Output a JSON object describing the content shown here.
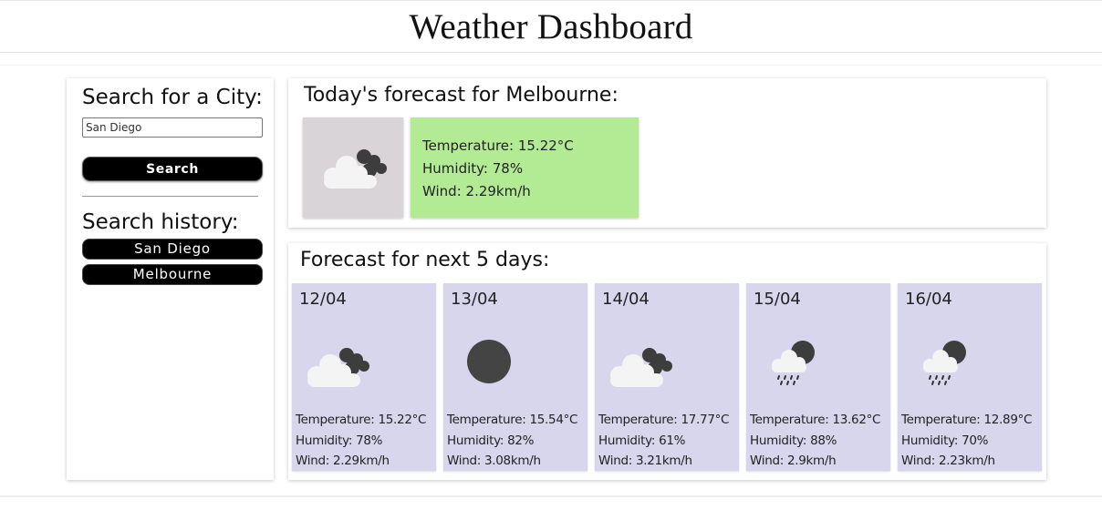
{
  "header": {
    "title": "Weather Dashboard"
  },
  "sidebar": {
    "search_heading": "Search for a City:",
    "input_value": "San Diego",
    "search_button": "Search",
    "history_heading": "Search history:",
    "history": [
      "San Diego",
      "Melbourne"
    ]
  },
  "today": {
    "heading": "Today's forecast for Melbourne:",
    "icon": "cloudy-partly-icon",
    "temperature": "Temperature: 15.22°C",
    "humidity": "Humidity: 78%",
    "wind": "Wind: 2.29km/h"
  },
  "forecast": {
    "heading": "Forecast for next 5 days:",
    "days": [
      {
        "date": "12/04",
        "icon": "cloudy-icon",
        "temperature": "Temperature: 15.22°C",
        "humidity": "Humidity: 78%",
        "wind": "Wind: 2.29km/h"
      },
      {
        "date": "13/04",
        "icon": "sun-icon",
        "temperature": "Temperature: 15.54°C",
        "humidity": "Humidity: 82%",
        "wind": "Wind: 3.08km/h"
      },
      {
        "date": "14/04",
        "icon": "cloudy-icon",
        "temperature": "Temperature: 17.77°C",
        "humidity": "Humidity: 61%",
        "wind": "Wind: 3.21km/h"
      },
      {
        "date": "15/04",
        "icon": "rain-icon",
        "temperature": "Temperature: 13.62°C",
        "humidity": "Humidity: 88%",
        "wind": "Wind: 2.9km/h"
      },
      {
        "date": "16/04",
        "icon": "rain-icon",
        "temperature": "Temperature: 12.89°C",
        "humidity": "Humidity: 70%",
        "wind": "Wind: 2.23km/h"
      }
    ]
  },
  "colors": {
    "today_stats_bg": "#b3eb95",
    "today_icon_bg": "#d8d4d7",
    "forecast_card_bg": "#d8d6ed",
    "button_bg": "#000000"
  }
}
